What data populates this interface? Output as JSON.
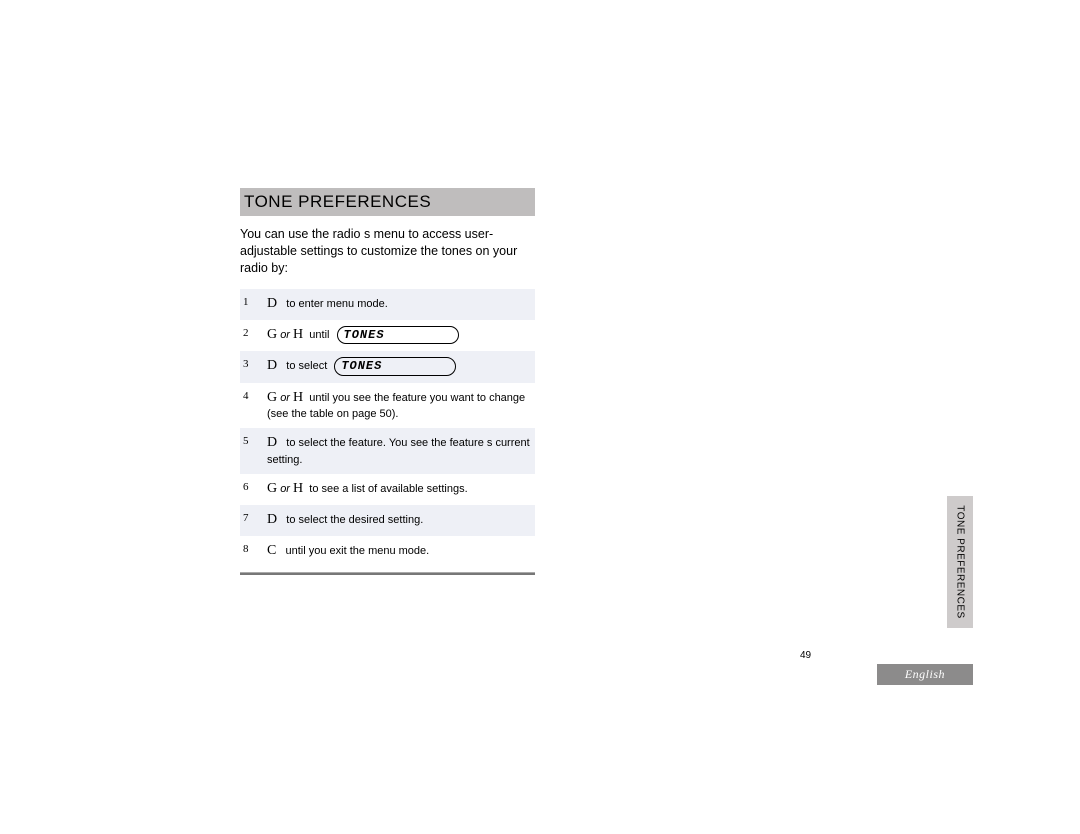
{
  "title": "TONE PREFERENCES",
  "intro": "You can use the radio s menu to access user-adjustable settings to customize the tones on your radio by:",
  "lcd": "TONES",
  "steps": {
    "s1": {
      "n": "1",
      "k": "D",
      "t": "to enter menu mode."
    },
    "s2": {
      "n": "2",
      "k1": "G",
      "or": "or",
      "k2": "H",
      "t": "until"
    },
    "s3": {
      "n": "3",
      "k": "D",
      "t": "to select"
    },
    "s4": {
      "n": "4",
      "k1": "G",
      "or": "or",
      "k2": "H",
      "t": "until you see the feature you want to change (see the table on page 50)."
    },
    "s5": {
      "n": "5",
      "k": "D",
      "t": "to select the feature. You see the feature s current setting."
    },
    "s6": {
      "n": "6",
      "k1": "G",
      "or": "or",
      "k2": "H",
      "t": "to see a list of available settings."
    },
    "s7": {
      "n": "7",
      "k": "D",
      "t": "to select the desired setting."
    },
    "s8": {
      "n": "8",
      "k": "C",
      "t": "until you exit the menu mode."
    }
  },
  "sidetab": "TONE PREFERENCES",
  "page_number": "49",
  "language": "English"
}
